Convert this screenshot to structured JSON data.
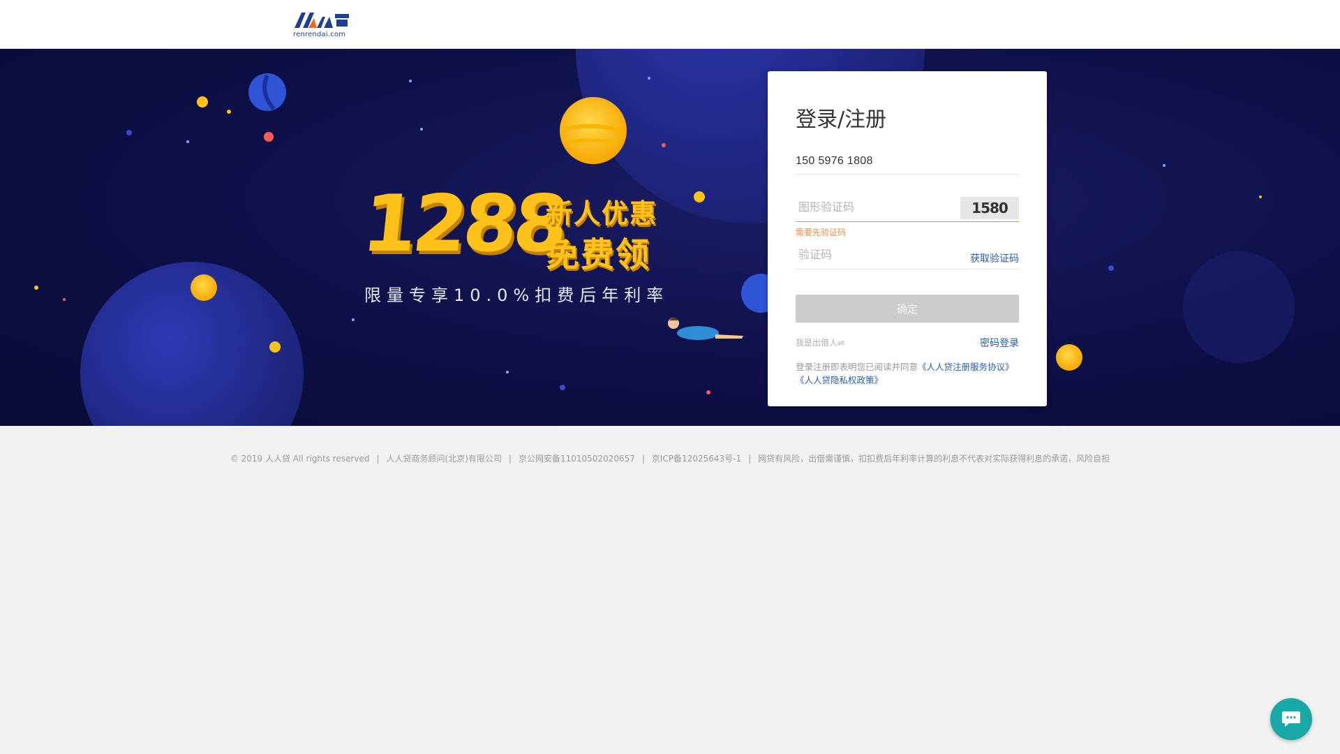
{
  "header": {
    "logo_alt": "人人贷",
    "logo_domain": "renrendai.com"
  },
  "banner": {
    "promo_amount": "1288",
    "promo_line1": "新人优惠券",
    "promo_line2": "免费领",
    "promo_sub": "限量专享10.0%扣费后年利率"
  },
  "login": {
    "title": "登录/注册",
    "phone_value": "150 5976 1808",
    "captcha_placeholder": "图形验证码",
    "captcha_image_text": "1580",
    "captcha_error": "需要先验证码",
    "sms_placeholder": "验证码",
    "get_code_label": "获取验证码",
    "confirm_label": "确定",
    "lender_link": "我是出借人⇌",
    "pwd_login_label": "密码登录",
    "agreement_prefix": "登录注册即表明您已阅读并同意",
    "agreement_link1": "《人人贷注册服务协议》",
    "agreement_link2": "《人人贷隐私权政策》"
  },
  "footer": {
    "copyright": "© 2019 人人贷 All rights reserved",
    "company": "人人贷商务顾问(北京)有限公司",
    "gongan": "京公网安备11010502020657",
    "icp": "京ICP备12025643号-1",
    "risk": "网贷有风险，出借需谨慎，扣扣费后年利率计算的利息不代表对实际获得利息的承诺，风险自担"
  },
  "colors": {
    "banner_bg": "#0d0f46",
    "promo_gold": "#ffc21a",
    "link_blue": "#2a5caa",
    "error_orange": "#f08a3e",
    "chat_teal": "#1aa7a8"
  },
  "icons": {
    "chat": "chat-bubble-icon"
  }
}
